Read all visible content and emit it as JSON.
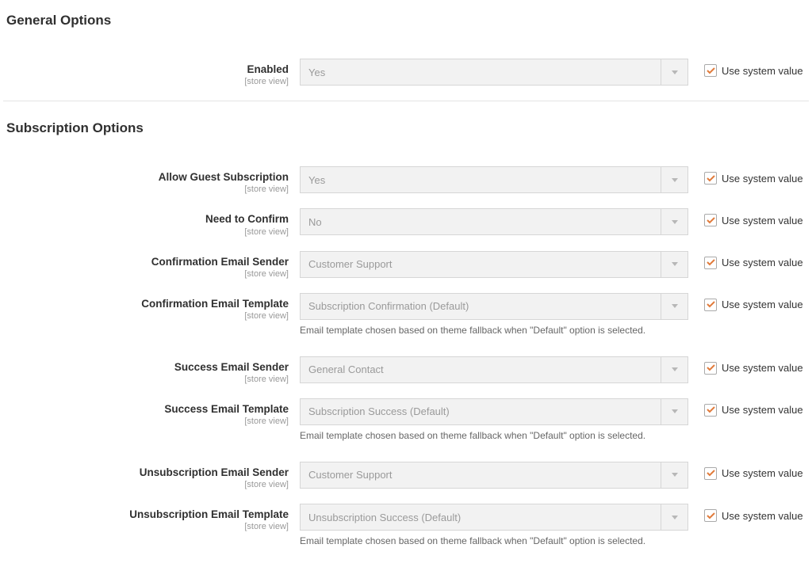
{
  "shared": {
    "scope_label": "[store view]",
    "use_system_label": "Use system value",
    "template_note": "Email template chosen based on theme fallback when \"Default\" option is selected."
  },
  "section_general": {
    "title": "General Options"
  },
  "section_subscription": {
    "title": "Subscription Options"
  },
  "fields": {
    "enabled": {
      "label": "Enabled",
      "value": "Yes"
    },
    "allow_guest": {
      "label": "Allow Guest Subscription",
      "value": "Yes"
    },
    "need_confirm": {
      "label": "Need to Confirm",
      "value": "No"
    },
    "confirm_sender": {
      "label": "Confirmation Email Sender",
      "value": "Customer Support"
    },
    "confirm_template": {
      "label": "Confirmation Email Template",
      "value": "Subscription Confirmation (Default)"
    },
    "success_sender": {
      "label": "Success Email Sender",
      "value": "General Contact"
    },
    "success_template": {
      "label": "Success Email Template",
      "value": "Subscription Success (Default)"
    },
    "unsub_sender": {
      "label": "Unsubscription Email Sender",
      "value": "Customer Support"
    },
    "unsub_template": {
      "label": "Unsubscription Email Template",
      "value": "Unsubscription Success (Default)"
    }
  }
}
